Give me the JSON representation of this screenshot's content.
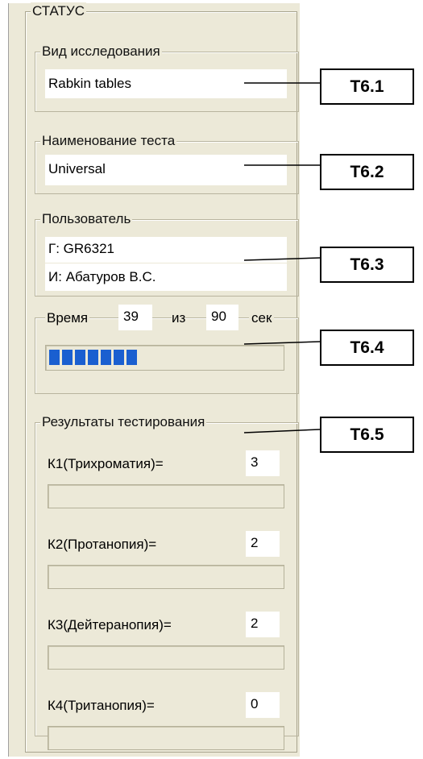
{
  "status_title": "СТАТУС",
  "study_type": {
    "title": "Вид исследования",
    "value": "Rabkin tables"
  },
  "test_name": {
    "title": "Наименование теста",
    "value": "Universal"
  },
  "user": {
    "title": "Пользователь",
    "group_label": "Г:",
    "group_value": "GR6321",
    "name_label": "И:",
    "name_value": "Абатуров В.С."
  },
  "time": {
    "label": "Время",
    "elapsed": "39",
    "of": "из",
    "total": "90",
    "unit": "сек",
    "progress": 0.433,
    "segments": 7
  },
  "results": {
    "title": "Результаты тестирования",
    "items": [
      {
        "label": "К1(Трихроматия)=",
        "value": "3"
      },
      {
        "label": "К2(Протанопия)=",
        "value": "2"
      },
      {
        "label": "К3(Дейтеранопия)=",
        "value": "2"
      },
      {
        "label": "К4(Тританопия)=",
        "value": "0"
      }
    ]
  },
  "callouts": [
    "T6.1",
    "T6.2",
    "T6.3",
    "T6.4",
    "T6.5"
  ]
}
